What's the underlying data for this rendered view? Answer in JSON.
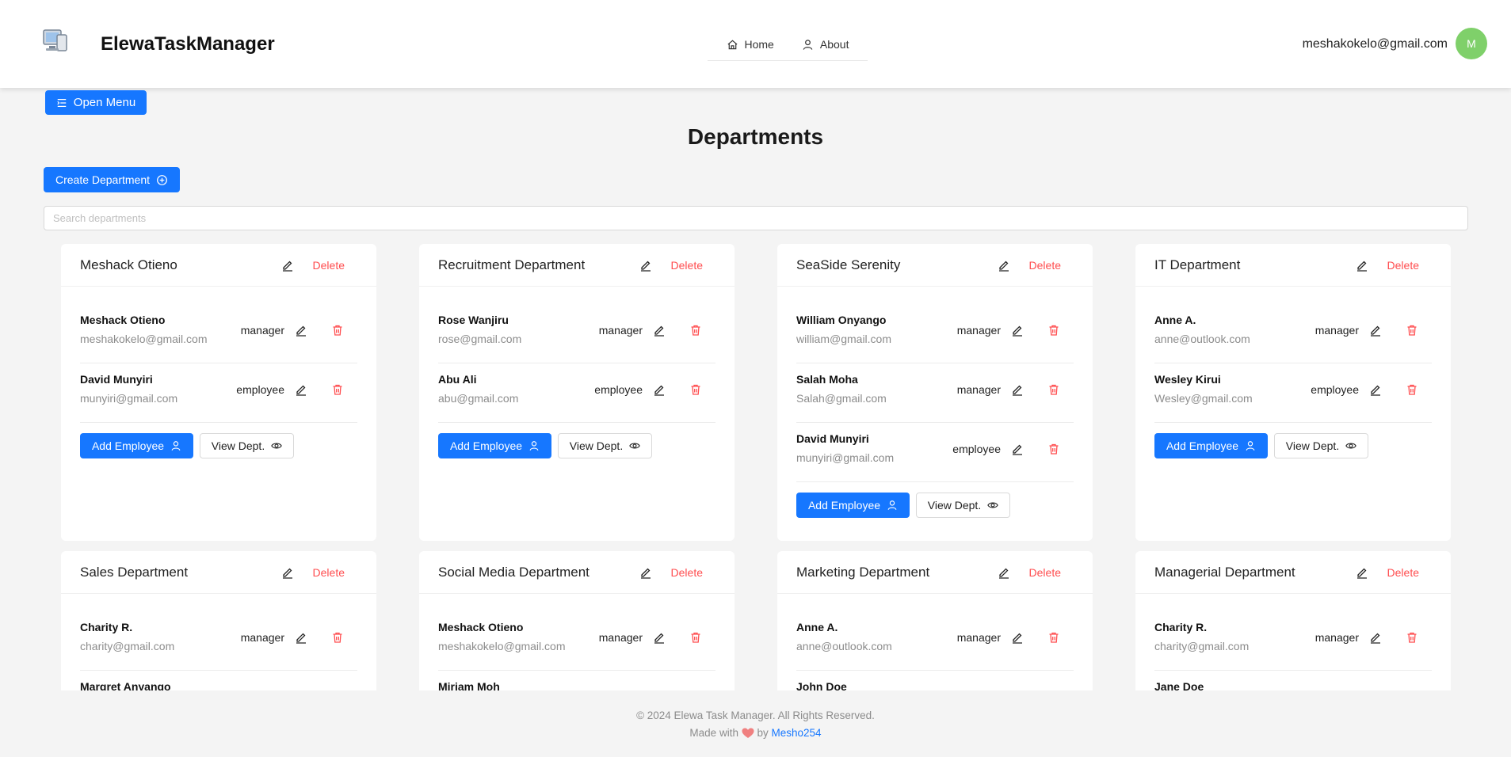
{
  "header": {
    "brand": "ElewaTaskManager",
    "nav": [
      {
        "label": "Home",
        "icon": "home-icon"
      },
      {
        "label": "About",
        "icon": "user-icon"
      }
    ],
    "user_email": "meshakokelo@gmail.com",
    "avatar_initial": "M",
    "avatar_color": "#7fd06a"
  },
  "toolbar": {
    "open_menu_label": "Open Menu",
    "create_label": "Create Department"
  },
  "page_title": "Departments",
  "search": {
    "placeholder": "Search departments",
    "value": ""
  },
  "colors": {
    "primary": "#1677ff",
    "danger": "#ff4d4f"
  },
  "card_labels": {
    "delete": "Delete",
    "add_employee": "Add Employee",
    "view_dept": "View Dept."
  },
  "departments": [
    {
      "name": "Meshack Otieno",
      "employees": [
        {
          "name": "Meshack Otieno",
          "email": "meshakokelo@gmail.com",
          "role": "manager"
        },
        {
          "name": "David Munyiri",
          "email": "munyiri@gmail.com",
          "role": "employee"
        }
      ]
    },
    {
      "name": "Recruitment Department",
      "employees": [
        {
          "name": "Rose Wanjiru",
          "email": "rose@gmail.com",
          "role": "manager"
        },
        {
          "name": "Abu Ali",
          "email": "abu@gmail.com",
          "role": "employee"
        }
      ]
    },
    {
      "name": "SeaSide Serenity",
      "employees": [
        {
          "name": "William Onyango",
          "email": "william@gmail.com",
          "role": "manager"
        },
        {
          "name": "Salah Moha",
          "email": "Salah@gmail.com",
          "role": "manager"
        },
        {
          "name": "David Munyiri",
          "email": "munyiri@gmail.com",
          "role": "employee"
        }
      ]
    },
    {
      "name": "IT Department",
      "employees": [
        {
          "name": "Anne A.",
          "email": "anne@outlook.com",
          "role": "manager"
        },
        {
          "name": "Wesley Kirui",
          "email": "Wesley@gmail.com",
          "role": "employee"
        }
      ]
    },
    {
      "name": "Sales Department",
      "employees": [
        {
          "name": "Charity R.",
          "email": "charity@gmail.com",
          "role": "manager"
        },
        {
          "name": "Margret Anyango",
          "email": "",
          "role": ""
        }
      ]
    },
    {
      "name": "Social Media Department",
      "employees": [
        {
          "name": "Meshack Otieno",
          "email": "meshakokelo@gmail.com",
          "role": "manager"
        },
        {
          "name": "Miriam Moh",
          "email": "",
          "role": ""
        }
      ]
    },
    {
      "name": "Marketing Department",
      "employees": [
        {
          "name": "Anne A.",
          "email": "anne@outlook.com",
          "role": "manager"
        },
        {
          "name": "John Doe",
          "email": "",
          "role": ""
        }
      ]
    },
    {
      "name": "Managerial Department",
      "employees": [
        {
          "name": "Charity R.",
          "email": "charity@gmail.com",
          "role": "manager"
        },
        {
          "name": "Jane Doe",
          "email": "",
          "role": ""
        }
      ]
    }
  ],
  "footer": {
    "copyright": "© 2024 Elewa Task Manager. All Rights Reserved.",
    "made_with": "Made with",
    "by": "by",
    "author": "Mesho254"
  }
}
